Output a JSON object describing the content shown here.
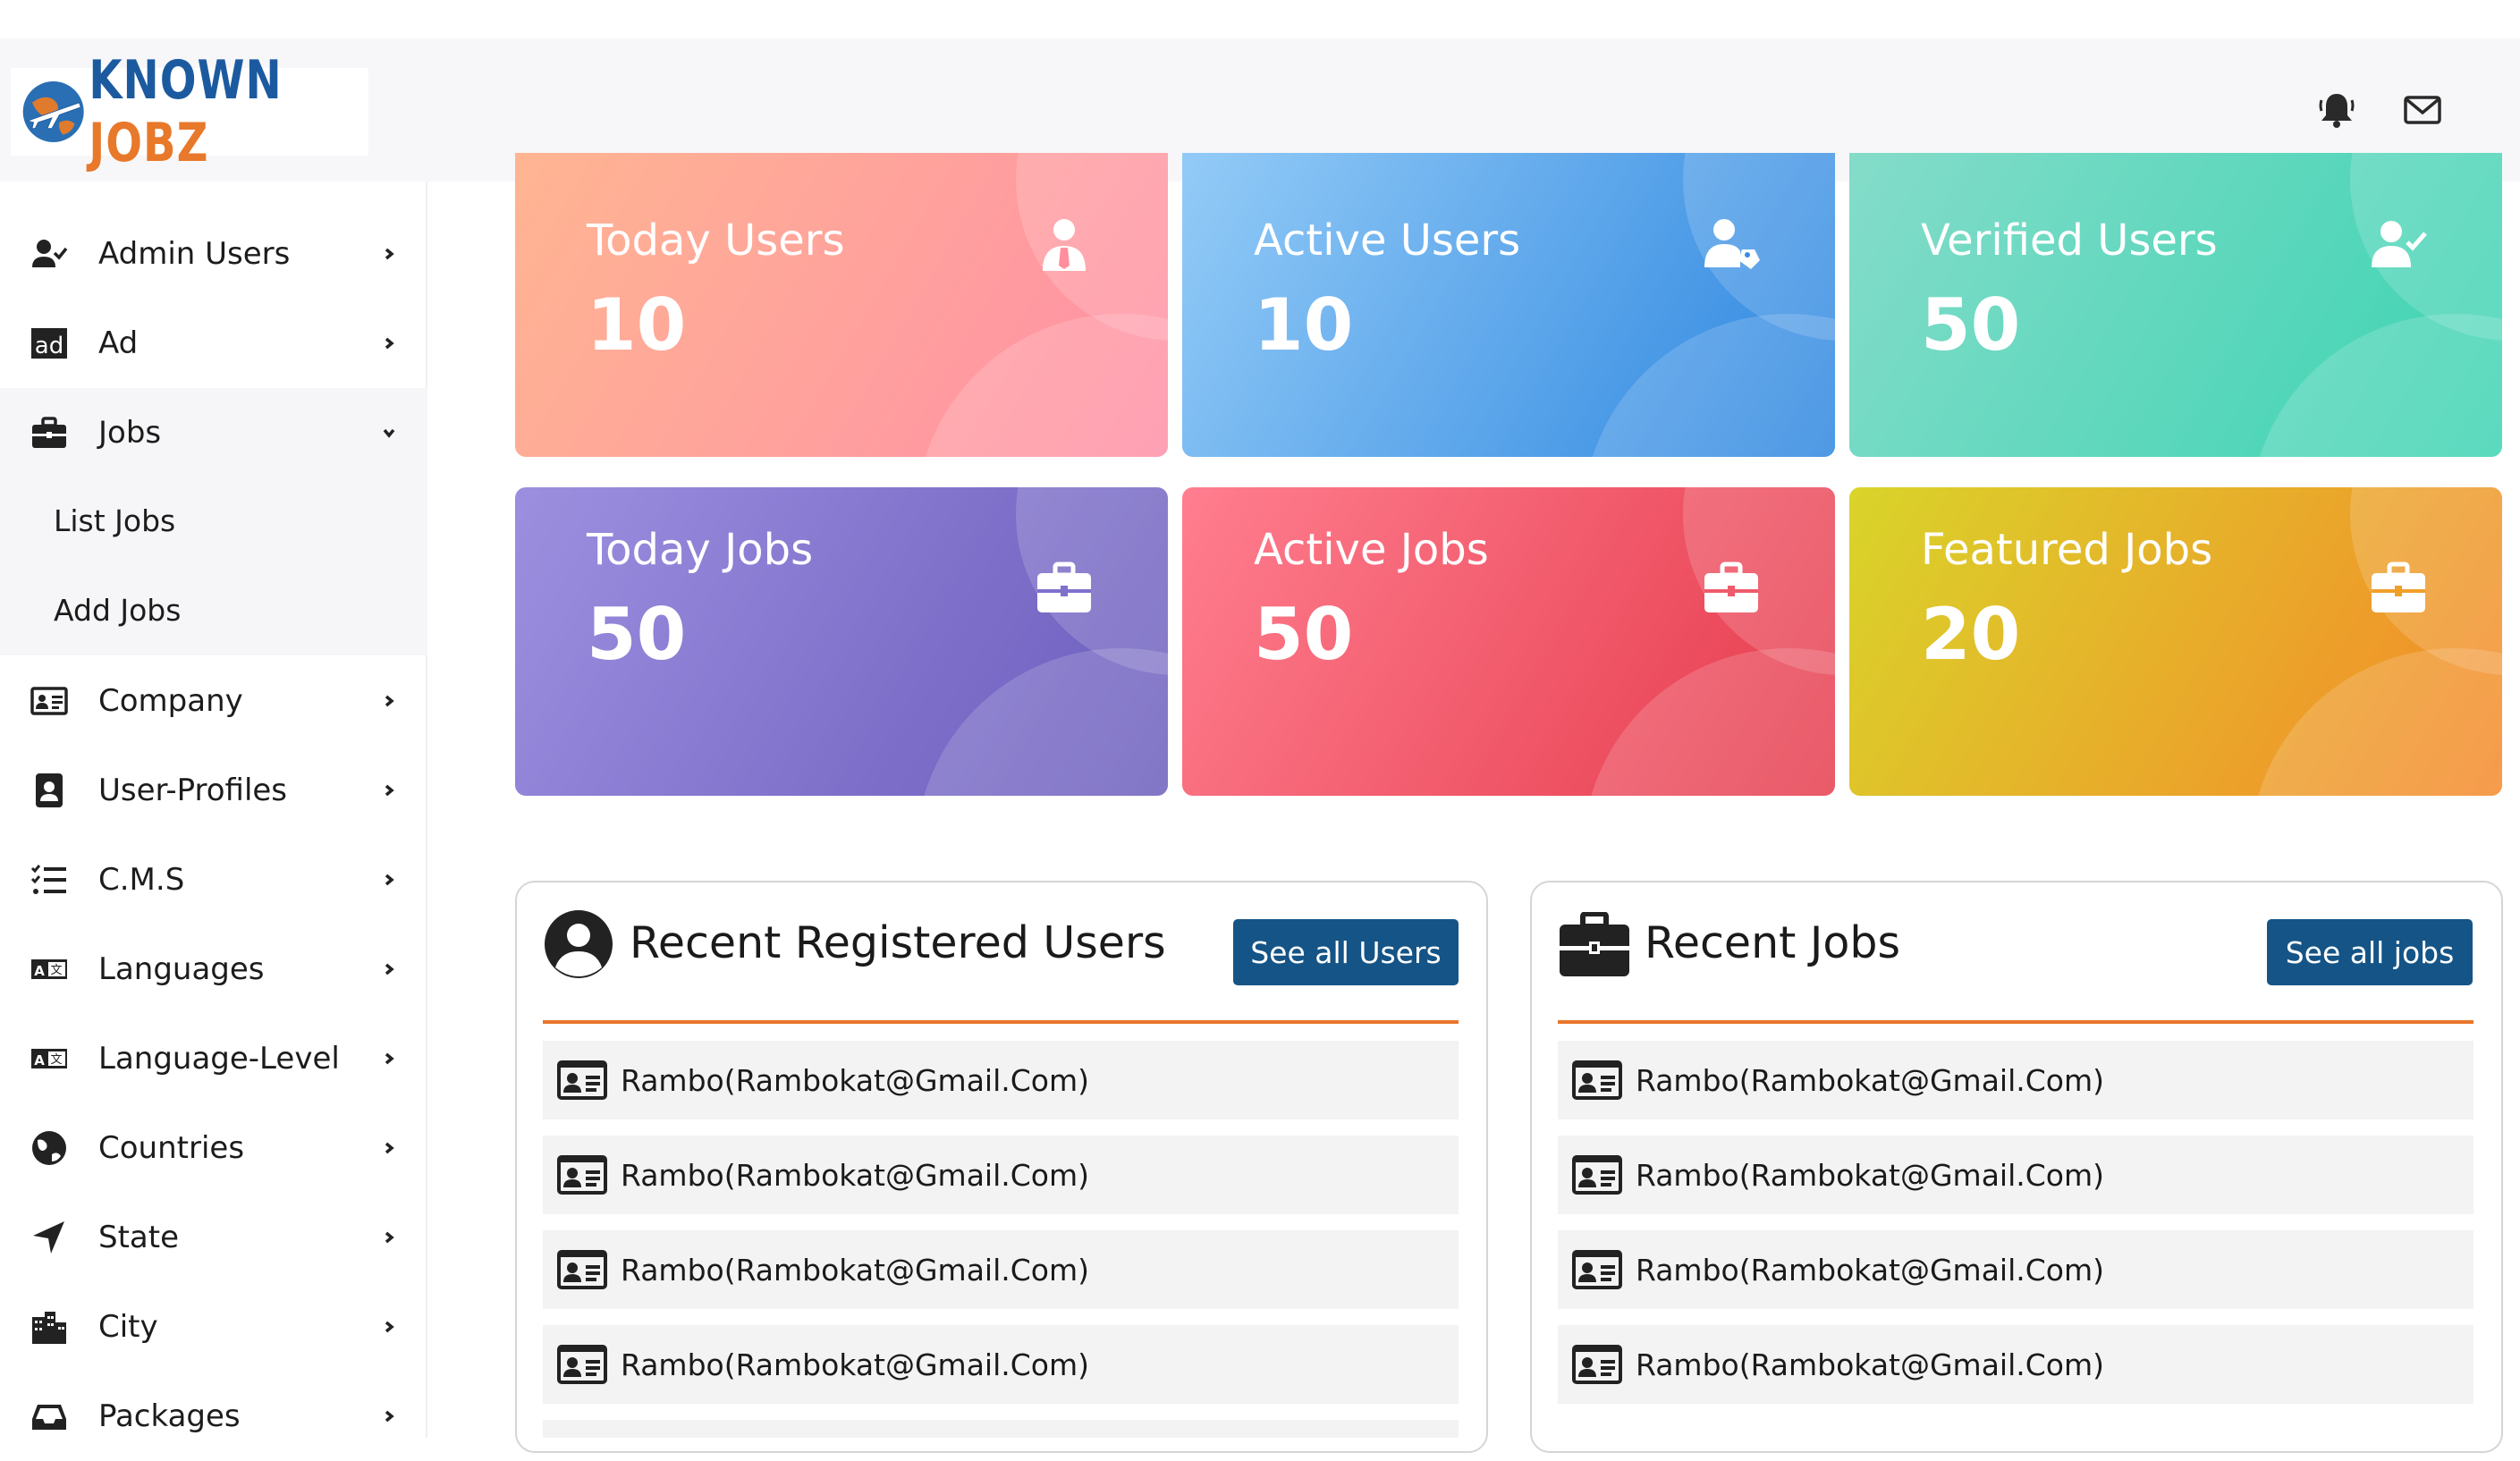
{
  "brand": {
    "logo_text": "KNOWN JOBZ",
    "logo_first": "KNOWN ",
    "logo_second": "JOBZ",
    "colors": {
      "orange": "#e8782a",
      "blue": "#1c5aa0"
    }
  },
  "header": {
    "icons": [
      "bell-icon",
      "mail-icon"
    ]
  },
  "sidebar": {
    "items": [
      {
        "label": "Admin Users",
        "icon": "user-check-icon"
      },
      {
        "label": "Ad",
        "icon": "ad-icon"
      },
      {
        "label": "Jobs",
        "icon": "briefcase-icon",
        "expanded": true
      },
      {
        "label": "Company",
        "icon": "id-card-icon"
      },
      {
        "label": "User-Profiles",
        "icon": "user-profile-icon"
      },
      {
        "label": "C.M.S",
        "icon": "list-check-icon"
      },
      {
        "label": "Languages",
        "icon": "language-icon"
      },
      {
        "label": "Language-Level",
        "icon": "language-icon"
      },
      {
        "label": "Countries",
        "icon": "globe-icon"
      },
      {
        "label": "State",
        "icon": "location-arrow-icon"
      },
      {
        "label": "City",
        "icon": "city-icon"
      },
      {
        "label": "Packages",
        "icon": "inbox-icon"
      }
    ],
    "jobs_submenu": [
      {
        "label": "List Jobs"
      },
      {
        "label": "Add Jobs"
      }
    ]
  },
  "stats": [
    {
      "title": "Today Users",
      "value": "10",
      "icon": "user-tie-icon",
      "gradient": [
        "#ffb592",
        "#ff8fa6"
      ]
    },
    {
      "title": "Active Users",
      "value": "10",
      "icon": "user-tag-icon",
      "gradient": [
        "#93cbf7",
        "#2d86e0"
      ]
    },
    {
      "title": "Verified Users",
      "value": "50",
      "icon": "user-check-icon",
      "gradient": [
        "#84dcc9",
        "#3cd3b2"
      ]
    },
    {
      "title": "Today Jobs",
      "value": "50",
      "icon": "briefcase-icon",
      "gradient": [
        "#9d8fdf",
        "#6a5cbc"
      ]
    },
    {
      "title": "Active Jobs",
      "value": "50",
      "icon": "briefcase-icon",
      "gradient": [
        "#ff7e8f",
        "#e53b4c"
      ]
    },
    {
      "title": "Featured Jobs",
      "value": "20",
      "icon": "briefcase-icon",
      "gradient": [
        "#d9d42a",
        "#f5882a"
      ]
    }
  ],
  "recent_users": {
    "title": "Recent Registered Users",
    "button": "See all Users",
    "rows": [
      "Rambo(Rambokat@Gmail.Com)",
      "Rambo(Rambokat@Gmail.Com)",
      "Rambo(Rambokat@Gmail.Com)",
      "Rambo(Rambokat@Gmail.Com)"
    ]
  },
  "recent_jobs": {
    "title": "Recent Jobs",
    "button": "See all jobs",
    "rows": [
      "Rambo(Rambokat@Gmail.Com)",
      "Rambo(Rambokat@Gmail.Com)",
      "Rambo(Rambokat@Gmail.Com)",
      "Rambo(Rambokat@Gmail.Com)"
    ]
  }
}
